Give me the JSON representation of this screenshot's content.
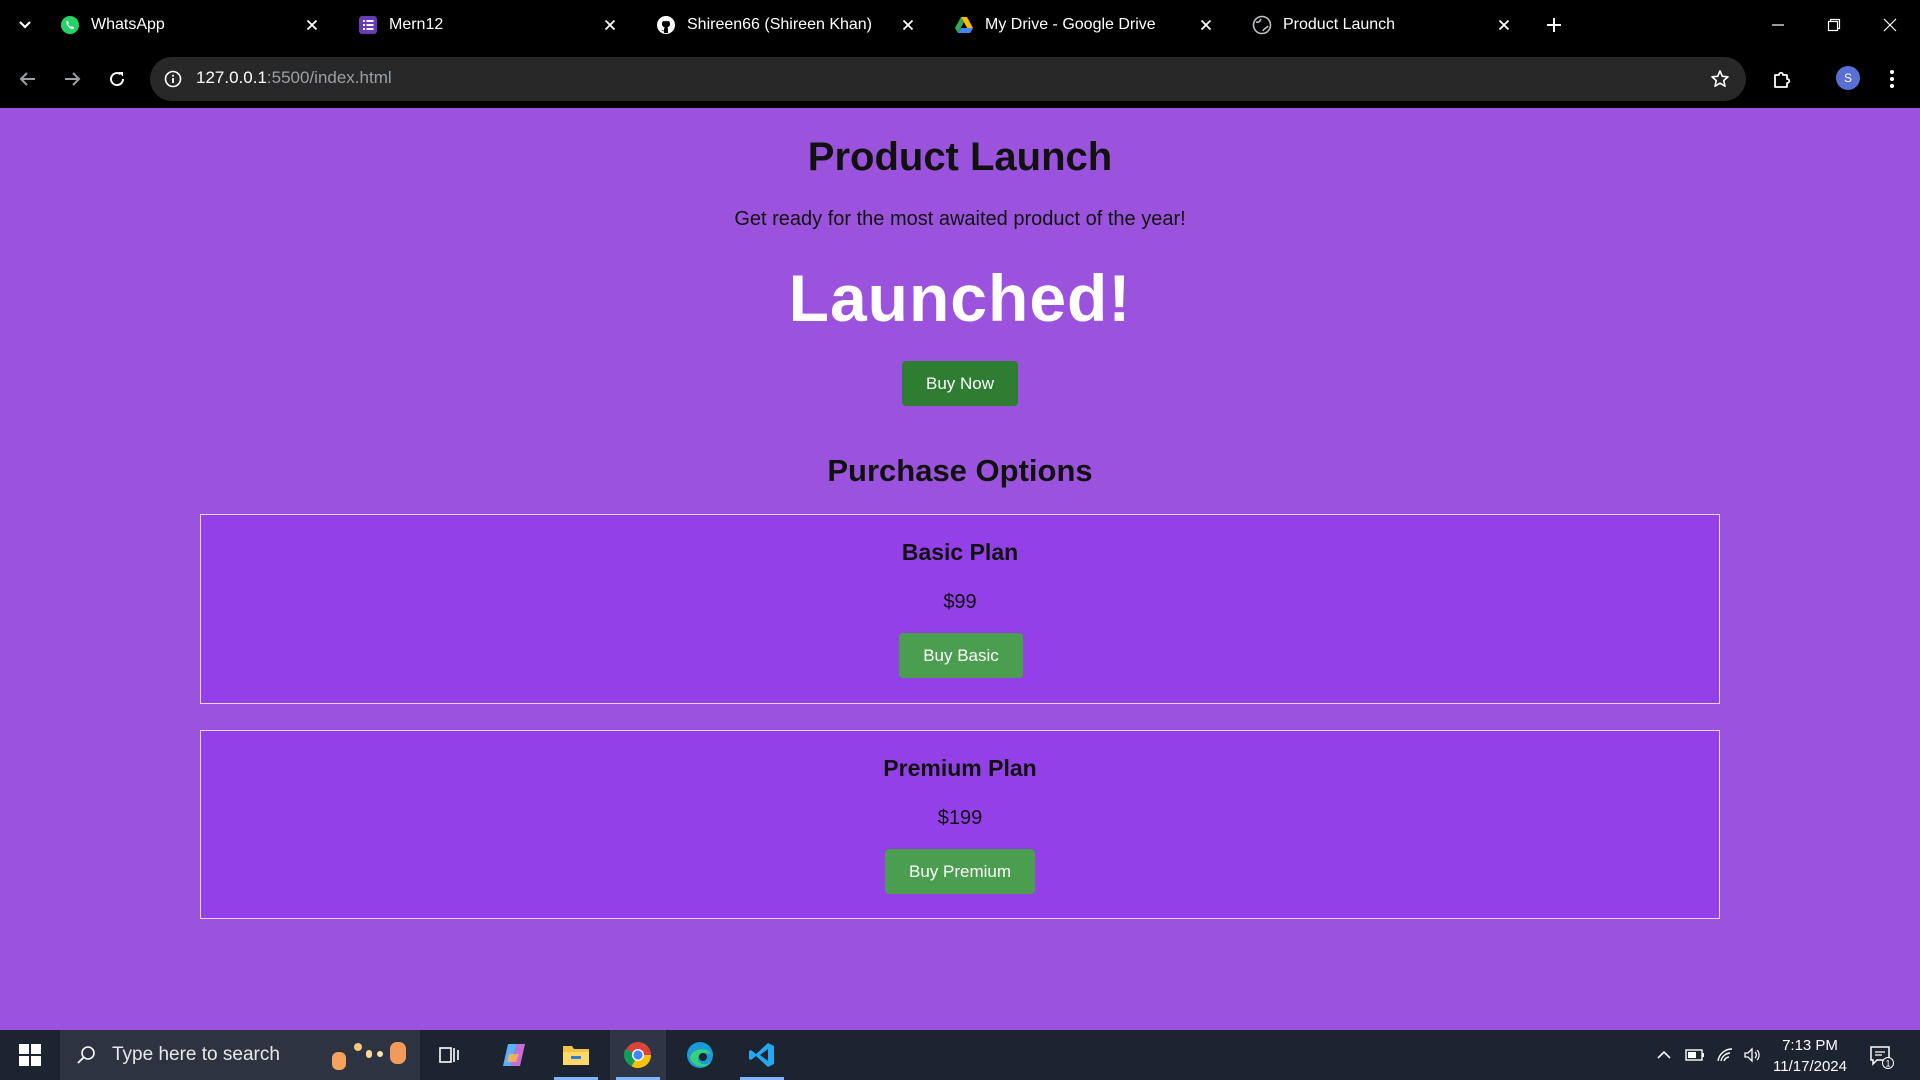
{
  "browser": {
    "tabs": [
      {
        "title": "WhatsApp",
        "icon": "whatsapp-icon",
        "color": "#25d366"
      },
      {
        "title": "Mern12",
        "icon": "forms-icon",
        "color": "#673ab7"
      },
      {
        "title": "Shireen66 (Shireen Khan)",
        "icon": "github-icon",
        "color": "#ffffff"
      },
      {
        "title": "My Drive - Google Drive",
        "icon": "google-drive-icon",
        "color": "#34a853"
      },
      {
        "title": "Product Launch",
        "icon": "globe-icon",
        "color": "#9aa0a6",
        "active": true
      }
    ],
    "url_host": "127.0.0.1",
    "url_rest": ":5500/index.html",
    "profile_initial": "S"
  },
  "page": {
    "title": "Product Launch",
    "tagline": "Get ready for the most awaited product of the year!",
    "countdown": "Launched!",
    "buy_now_label": "Buy Now",
    "options_heading": "Purchase Options",
    "plans": [
      {
        "name": "Basic Plan",
        "price": "$99",
        "button": "Buy Basic"
      },
      {
        "name": "Premium Plan",
        "price": "$199",
        "button": "Buy Premium"
      }
    ]
  },
  "colors": {
    "page_background": "#9b53de",
    "plan_background": "#9340e8",
    "buy_now": "#2e7d32",
    "plan_button": "#4b9d4f",
    "countdown_text": "#ffffff"
  },
  "taskbar": {
    "search_placeholder": "Type here to search",
    "apps": [
      "task-view-icon",
      "copilot-icon",
      "file-explorer-icon",
      "chrome-icon",
      "edge-icon",
      "vscode-icon"
    ],
    "time": "7:13 PM",
    "date": "11/17/2024",
    "notification_count": "1"
  }
}
